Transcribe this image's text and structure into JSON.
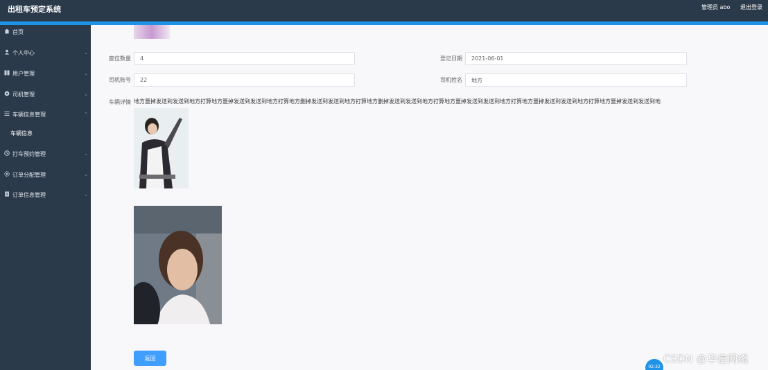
{
  "header": {
    "app_title": "出租车预定系统",
    "user_label": "管理员 abo",
    "logout_label": "退出登录"
  },
  "sidebar": {
    "items": [
      {
        "label": "首页",
        "icon": "home-icon",
        "has_chevron": false
      },
      {
        "label": "个人中心",
        "icon": "user-icon",
        "has_chevron": true
      },
      {
        "label": "用户管理",
        "icon": "grid-icon",
        "has_chevron": true
      },
      {
        "label": "司机管理",
        "icon": "driver-icon",
        "has_chevron": true
      },
      {
        "label": "车辆信息管理",
        "icon": "list-icon",
        "has_chevron": true
      },
      {
        "label": "车辆信息",
        "icon": "",
        "has_chevron": false
      },
      {
        "label": "打车预约管理",
        "icon": "clock-icon",
        "has_chevron": true
      },
      {
        "label": "订单分配管理",
        "icon": "settings-icon",
        "has_chevron": true
      },
      {
        "label": "订单信息管理",
        "icon": "doc-icon",
        "has_chevron": true
      }
    ]
  },
  "form": {
    "seats_label": "座位数量",
    "seats_value": "4",
    "register_date_label": "登记日期",
    "register_date_value": "2021-06-01",
    "driver_account_label": "司机账号",
    "driver_account_value": "22",
    "driver_name_label": "司机姓名",
    "driver_name_value": "地方",
    "vehicle_detail_label": "车辆详情",
    "vehicle_detail_text": "地方噩掉发送到发送到地方打算地方噩掉发送到发送到地方打算地方删掉发送到发送到地方打算地方删掉发送到发送到地方打算地方噩掉发送到发送到地方打算地方噩掉发送到发送到地方打算地方噩掉发送到发送到地方打算"
  },
  "actions": {
    "back_label": "返回"
  },
  "overlay": {
    "watermark": "CSDN @华信网络",
    "bubble_time": "02:32"
  },
  "colors": {
    "topbar": "#2b3a4a",
    "accent": "#1f93e8",
    "button": "#409eff"
  }
}
